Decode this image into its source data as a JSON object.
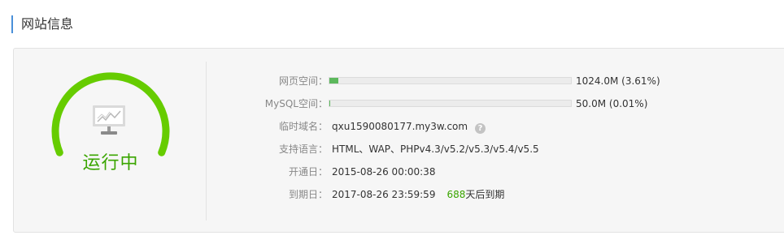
{
  "section": {
    "title": "网站信息"
  },
  "status": {
    "text": "运行中",
    "color": "#3aa500",
    "icon": "monitor-chart-icon"
  },
  "colors": {
    "accent": "#4a90d9",
    "gauge": "#66cc00",
    "bar_fill": "#5cb85c",
    "days_highlight": "#3aa500"
  },
  "info": {
    "web_space": {
      "label": "网页空间：",
      "usage_text": "1024.0M (3.61%)",
      "percent": 3.61
    },
    "mysql_space": {
      "label": "MySQL空间：",
      "usage_text": "50.0M (0.01%)",
      "percent": 0.01
    },
    "temp_domain": {
      "label": "临时域名：",
      "value": "qxu1590080177.my3w.com",
      "help": "?"
    },
    "languages": {
      "label": "支持语言：",
      "value": "HTML、WAP、PHPv4.3/v5.2/v5.3/v5.4/v5.5"
    },
    "open_date": {
      "label": "开通日：",
      "value": "2015-08-26 00:00:38"
    },
    "expire_date": {
      "label": "到期日：",
      "value": "2017-08-26 23:59:59",
      "days": "688",
      "days_suffix": "天后到期"
    }
  }
}
